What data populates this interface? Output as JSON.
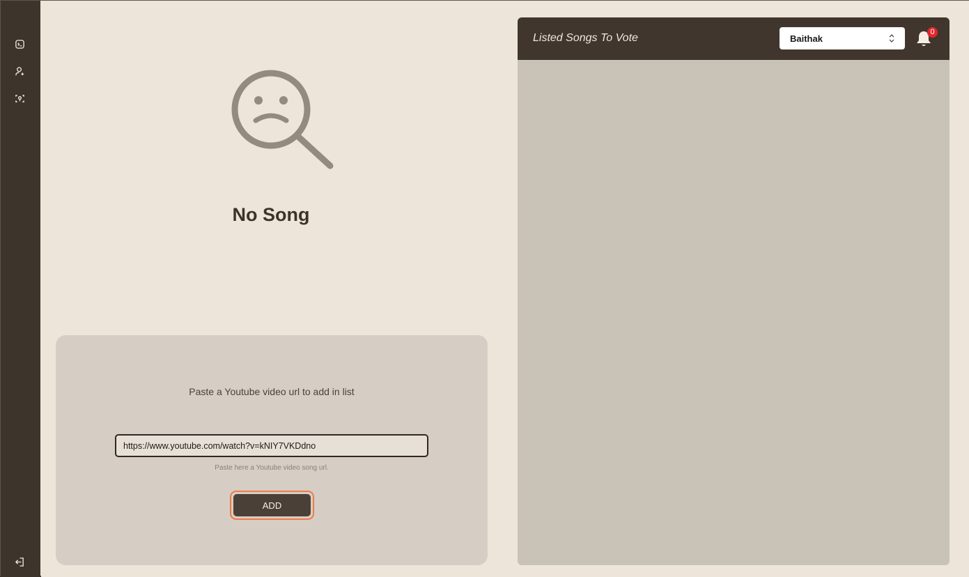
{
  "sidebar": {
    "items": [
      {
        "icon": "terminal-icon"
      },
      {
        "icon": "user-add-icon"
      },
      {
        "icon": "scan-icon"
      }
    ],
    "logout_icon": "logout-icon"
  },
  "empty_state": {
    "icon": "sad-magnifier-icon",
    "title": "No Song"
  },
  "add_song": {
    "prompt": "Paste a Youtube video url to add in list",
    "input_value": "https://www.youtube.com/watch?v=kNIY7VKDdno",
    "helper_text": "Paste here a Youtube video song url.",
    "add_label": "ADD"
  },
  "vote_panel": {
    "title": "Listed Songs To Vote",
    "room_selected": "Baithak",
    "notification_count": "0"
  },
  "colors": {
    "background": "#ede5da",
    "sidebar": "#3d342c",
    "accent_ring": "#f07a49",
    "badge": "#e3262d"
  }
}
